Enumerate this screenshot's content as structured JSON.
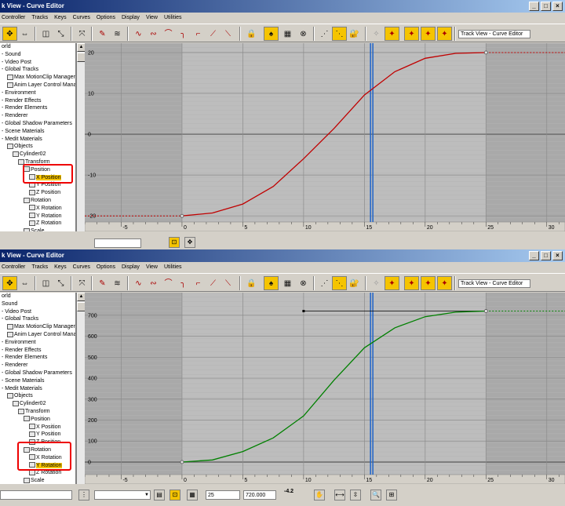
{
  "windows": [
    {
      "id": "w1",
      "title": "k View - Curve Editor",
      "view_name": "Track View - Curve Editor",
      "highlight_track": "X Position",
      "chart_data": {
        "type": "line",
        "title": "",
        "xlabel": "",
        "ylabel": "",
        "xlim": [
          -8,
          31.5
        ],
        "ylim": [
          -21.5,
          22.3
        ],
        "x_ticks": [
          -5,
          0,
          5,
          10,
          15,
          20,
          25,
          30
        ],
        "y_ticks": [
          20,
          10,
          0,
          -10,
          -20
        ],
        "current_frame": 15.6,
        "series": [
          {
            "color": "#c00000",
            "x": [
              0,
              2.5,
              5,
              7.5,
              10,
              12.5,
              15,
              17.5,
              20,
              22.5,
              25
            ],
            "y": [
              -20,
              -19.3,
              -17.1,
              -12.8,
              -6.0,
              1.4,
              9.6,
              15.3,
              18.6,
              19.8,
              20
            ]
          }
        ],
        "keys": [
          {
            "x": 0,
            "y": -20
          },
          {
            "x": 25,
            "y": 20
          }
        ],
        "out_of_range_left_y": -20,
        "out_of_range_right_y": 20
      }
    },
    {
      "id": "w2",
      "title": "k View - Curve Editor",
      "view_name": "Track View - Curve Editor",
      "highlight_track": "Y Rotation",
      "chart_data": {
        "type": "line",
        "title": "",
        "xlabel": "",
        "ylabel": "",
        "xlim": [
          -8,
          31.5
        ],
        "ylim": [
          -60,
          808
        ],
        "x_ticks": [
          -5,
          0,
          5,
          10,
          15,
          20,
          25,
          30
        ],
        "y_ticks": [
          700,
          600,
          500,
          400,
          300,
          200,
          100,
          0
        ],
        "current_frame": 15.6,
        "series": [
          {
            "color": "#008000",
            "x": [
              0,
              2.5,
              5,
              7.5,
              10,
              12.5,
              15,
              17.5,
              20,
              22.5,
              25
            ],
            "y": [
              0,
              10,
              50,
              115,
              220,
              390,
              545,
              640,
              693,
              715,
              720
            ]
          }
        ],
        "keys": [
          {
            "x": 0,
            "y": 0
          },
          {
            "x": 25,
            "y": 720
          }
        ],
        "tangent_handle": {
          "x1": 10,
          "x2": 25,
          "y": 720
        },
        "out_of_range_right_y": 720
      }
    }
  ],
  "menu": [
    "Controller",
    "Tracks",
    "Keys",
    "Curves",
    "Options",
    "Display",
    "View",
    "Utilities"
  ],
  "tree_top": [
    {
      "label": "orld",
      "indent": 0
    },
    {
      "label": "- Sound",
      "indent": 0
    },
    {
      "label": "- Video Post",
      "indent": 0
    },
    {
      "label": "- Global Tracks",
      "indent": 0
    },
    {
      "label": "Max MotionClip Manager",
      "indent": 1
    },
    {
      "label": "Anim Layer Control Manager",
      "indent": 1
    },
    {
      "label": "- Environment",
      "indent": 0
    },
    {
      "label": "- Render Effects",
      "indent": 0
    },
    {
      "label": "- Render Elements",
      "indent": 0
    },
    {
      "label": "- Renderer",
      "indent": 0
    },
    {
      "label": "- Global Shadow Parameters",
      "indent": 0
    },
    {
      "label": "- Scene Materials",
      "indent": 0
    },
    {
      "label": "- Medit Materials",
      "indent": 0
    },
    {
      "label": "Objects",
      "indent": 1
    },
    {
      "label": "Cylinder02",
      "indent": 2
    },
    {
      "label": "Transform",
      "indent": 3
    },
    {
      "label": "Position",
      "indent": 4
    },
    {
      "label": "X Position",
      "indent": 5
    },
    {
      "label": "Y Position",
      "indent": 5
    },
    {
      "label": "Z Position",
      "indent": 5
    },
    {
      "label": "Rotation",
      "indent": 4
    },
    {
      "label": "X Rotation",
      "indent": 5
    },
    {
      "label": "Y Rotation",
      "indent": 5
    },
    {
      "label": "Z Rotation",
      "indent": 5
    },
    {
      "label": "Scale",
      "indent": 4
    }
  ],
  "tree_bottom": [
    {
      "label": "orld",
      "indent": 0
    },
    {
      "label": "Sound",
      "indent": 0
    },
    {
      "label": "- Video Post",
      "indent": 0
    },
    {
      "label": "- Global Tracks",
      "indent": 0
    },
    {
      "label": "Max MotionClip Manager",
      "indent": 1
    },
    {
      "label": "Anim Layer Control Manager",
      "indent": 1
    },
    {
      "label": "- Environment",
      "indent": 0
    },
    {
      "label": "- Render Effects",
      "indent": 0
    },
    {
      "label": "- Render Elements",
      "indent": 0
    },
    {
      "label": "- Renderer",
      "indent": 0
    },
    {
      "label": "- Global Shadow Parameters",
      "indent": 0
    },
    {
      "label": "- Scene Materials",
      "indent": 0
    },
    {
      "label": "- Medit Materials",
      "indent": 0
    },
    {
      "label": "Objects",
      "indent": 1
    },
    {
      "label": "Cylinder02",
      "indent": 2
    },
    {
      "label": "Transform",
      "indent": 3
    },
    {
      "label": "Position",
      "indent": 4
    },
    {
      "label": "X Position",
      "indent": 5
    },
    {
      "label": "Y Position",
      "indent": 5
    },
    {
      "label": "Z Position",
      "indent": 5
    },
    {
      "label": "Rotation",
      "indent": 4
    },
    {
      "label": "X Rotation",
      "indent": 5
    },
    {
      "label": "Y Rotation",
      "indent": 5
    },
    {
      "label": "Z Rotation",
      "indent": 5
    },
    {
      "label": "Scale",
      "indent": 4
    }
  ],
  "status": {
    "frame_value": "25",
    "key_value": "720.000",
    "zoom_label": "-4.2"
  },
  "colors": {
    "accent": "#f5c400",
    "title_start": "#0a246a",
    "title_end": "#a6caf0"
  }
}
